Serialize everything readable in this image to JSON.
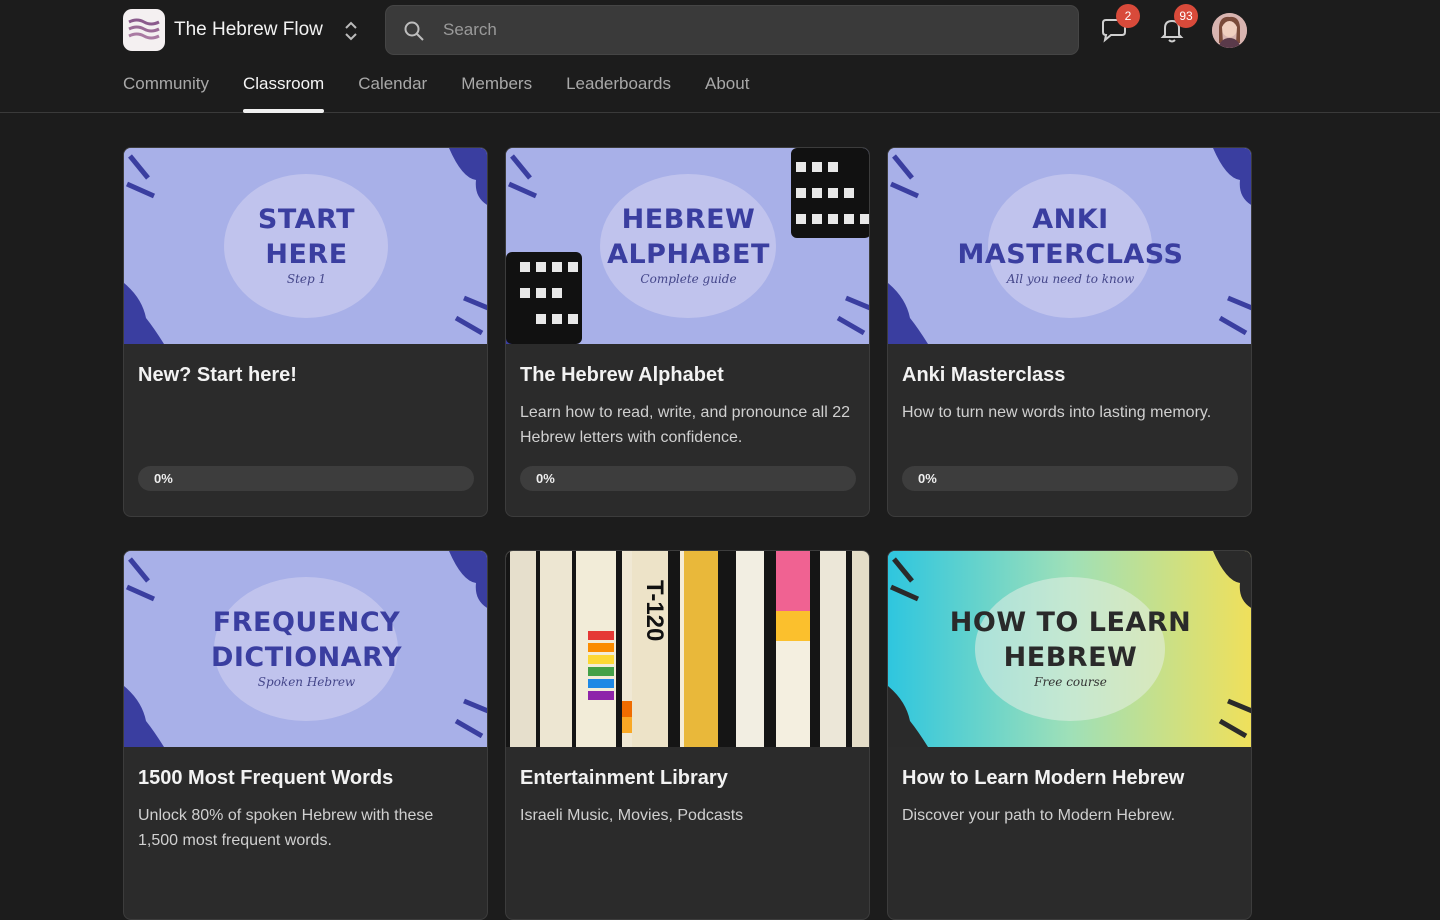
{
  "header": {
    "brand": "The Hebrew Flow",
    "search_placeholder": "Search",
    "chat_badge": "2",
    "notif_badge": "93"
  },
  "tabs": [
    {
      "label": "Community",
      "active": false
    },
    {
      "label": "Classroom",
      "active": true
    },
    {
      "label": "Calendar",
      "active": false
    },
    {
      "label": "Members",
      "active": false
    },
    {
      "label": "Leaderboards",
      "active": false
    },
    {
      "label": "About",
      "active": false
    }
  ],
  "colors": {
    "background": "#1c1c1c",
    "card": "#2b2b2b",
    "thumb_lavender": "#a8b0e8",
    "thumb_accent": "#3a3ea0",
    "badge": "#d84a3a"
  },
  "courses": [
    {
      "thumb_line1": "START",
      "thumb_line2": "HERE",
      "thumb_sub": "Step 1",
      "title": "New? Start here!",
      "description": "",
      "progress": "0%"
    },
    {
      "thumb_line1": "HEBREW",
      "thumb_line2": "ALPHABET",
      "thumb_sub": "Complete guide",
      "title": "The Hebrew Alphabet",
      "description": "Learn how to read, write, and pronounce all 22 Hebrew letters with confidence.",
      "progress": "0%"
    },
    {
      "thumb_line1": "ANKI",
      "thumb_line2": "MASTERCLASS",
      "thumb_sub": "All you need to know",
      "title": "Anki Masterclass",
      "description": "How to turn new words into lasting memory.",
      "progress": "0%"
    },
    {
      "thumb_line1": "FREQUENCY",
      "thumb_line2": "DICTIONARY",
      "thumb_sub": "Spoken Hebrew",
      "title": "1500 Most Frequent Words",
      "description": "Unlock 80% of spoken Hebrew with these 1,500 most frequent words."
    },
    {
      "thumb_text": "T-120",
      "title": "Entertainment Library",
      "description": "Israeli Music, Movies, Podcasts"
    },
    {
      "thumb_line1": "HOW TO LEARN",
      "thumb_line2": "HEBREW",
      "thumb_sub": "Free course",
      "title": "How to Learn Modern Hebrew",
      "description": "Discover your path to Modern Hebrew."
    }
  ]
}
